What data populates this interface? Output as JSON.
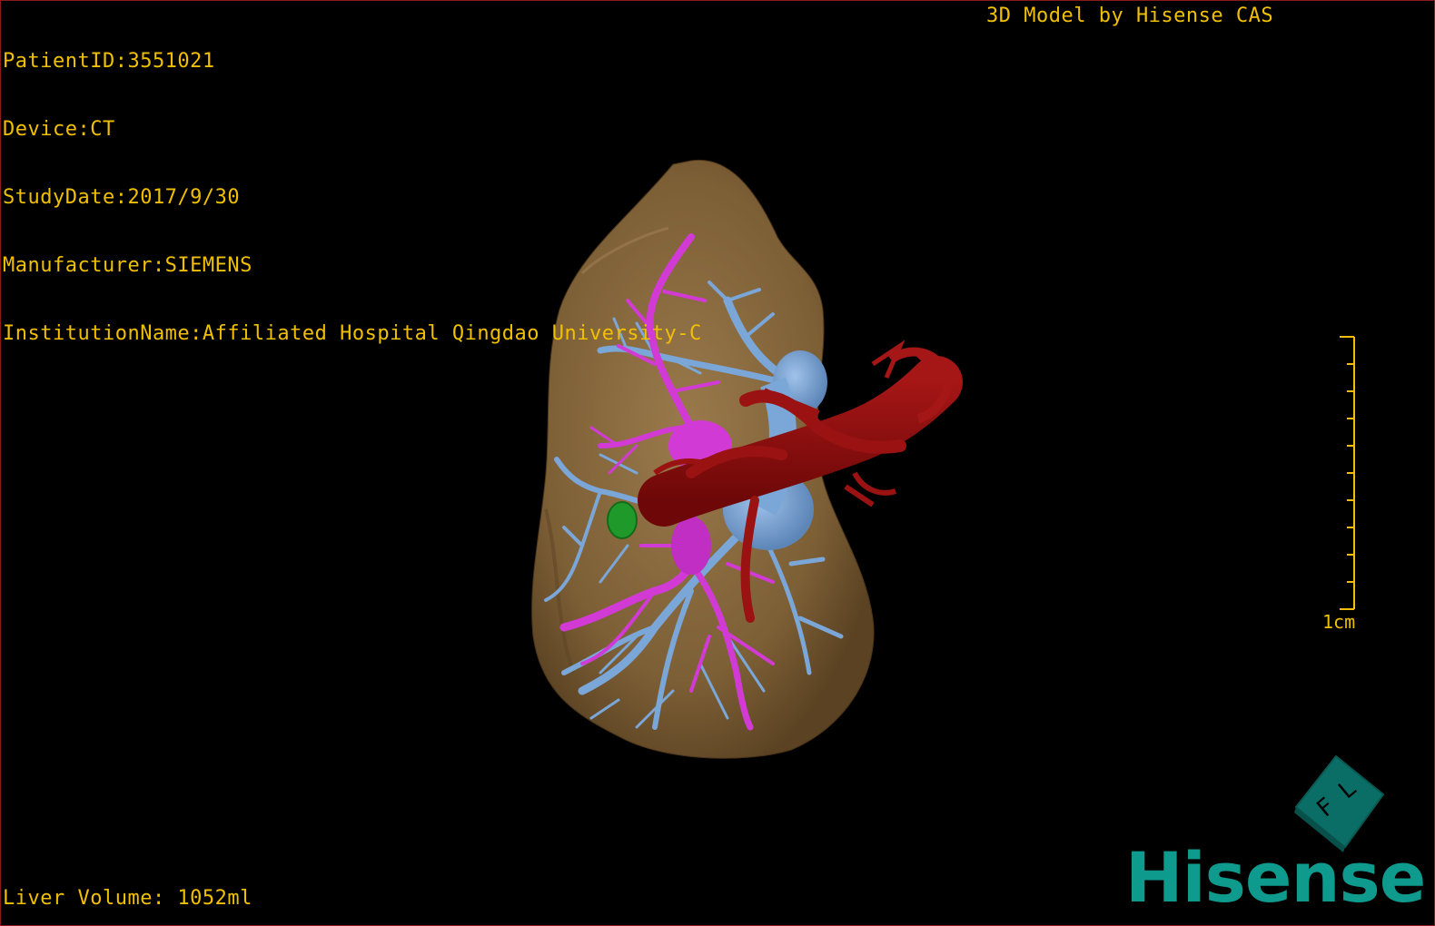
{
  "patient": {
    "id_line": "PatientID:3551021",
    "device_line": "Device:CT",
    "study_date_line": "StudyDate:2017/9/30",
    "manufacturer_line": "Manufacturer:SIEMENS",
    "institution_line": "InstitutionName:Affiliated Hospital Qingdao University-C"
  },
  "header_right": "3D Model by Hisense CAS",
  "footer": {
    "liver_volume": "Liver Volume: 1052ml"
  },
  "scale_bar": {
    "label": "1cm",
    "ticks": 10
  },
  "logo": {
    "cube_letters": "F L",
    "wordmark": "Hisense"
  },
  "colors": {
    "overlay_text": "#f0c000",
    "liver": "#8a6a3e",
    "hepatic_vein": "#7aa6d8",
    "portal_vein": "#d23ad6",
    "artery": "#8c0f0f",
    "lesion": "#1f9a2a",
    "brand": "#0e9a8c",
    "border": "#8b1a1a"
  },
  "structures": [
    "liver-surface",
    "hepatic-veins",
    "portal-veins",
    "arteries-ivc",
    "green-lesion"
  ]
}
